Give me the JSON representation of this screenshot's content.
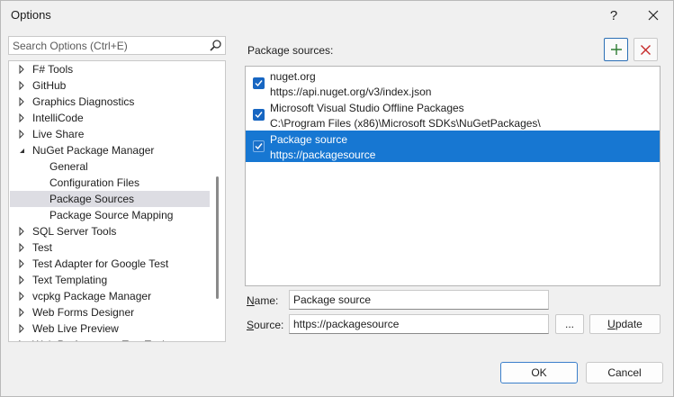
{
  "window": {
    "title": "Options",
    "help_label": "?"
  },
  "search": {
    "placeholder": "Search Options (Ctrl+E)"
  },
  "tree": {
    "items": [
      {
        "label": "F# Tools",
        "level": 0,
        "expandable": true,
        "expanded": false
      },
      {
        "label": "GitHub",
        "level": 0,
        "expandable": true,
        "expanded": false
      },
      {
        "label": "Graphics Diagnostics",
        "level": 0,
        "expandable": true,
        "expanded": false
      },
      {
        "label": "IntelliCode",
        "level": 0,
        "expandable": true,
        "expanded": false
      },
      {
        "label": "Live Share",
        "level": 0,
        "expandable": true,
        "expanded": false
      },
      {
        "label": "NuGet Package Manager",
        "level": 0,
        "expandable": true,
        "expanded": true
      },
      {
        "label": "General",
        "level": 1,
        "expandable": false
      },
      {
        "label": "Configuration Files",
        "level": 1,
        "expandable": false
      },
      {
        "label": "Package Sources",
        "level": 1,
        "expandable": false,
        "selected": true
      },
      {
        "label": "Package Source Mapping",
        "level": 1,
        "expandable": false
      },
      {
        "label": "SQL Server Tools",
        "level": 0,
        "expandable": true,
        "expanded": false
      },
      {
        "label": "Test",
        "level": 0,
        "expandable": true,
        "expanded": false
      },
      {
        "label": "Test Adapter for Google Test",
        "level": 0,
        "expandable": true,
        "expanded": false
      },
      {
        "label": "Text Templating",
        "level": 0,
        "expandable": true,
        "expanded": false
      },
      {
        "label": "vcpkg Package Manager",
        "level": 0,
        "expandable": true,
        "expanded": false
      },
      {
        "label": "Web Forms Designer",
        "level": 0,
        "expandable": true,
        "expanded": false
      },
      {
        "label": "Web Live Preview",
        "level": 0,
        "expandable": true,
        "expanded": false
      },
      {
        "label": "Web Performance Test Tools",
        "level": 0,
        "expandable": true,
        "expanded": false
      }
    ]
  },
  "sources_panel": {
    "label": "Package sources:",
    "add_icon": "plus-icon",
    "remove_icon": "x-icon",
    "sources": [
      {
        "name": "nuget.org",
        "url": "https://api.nuget.org/v3/index.json",
        "checked": true,
        "selected": false
      },
      {
        "name": "Microsoft Visual Studio Offline Packages",
        "url": "C:\\Program Files (x86)\\Microsoft SDKs\\NuGetPackages\\",
        "checked": true,
        "selected": false
      },
      {
        "name": "Package source",
        "url": "https://packagesource",
        "checked": true,
        "selected": true
      }
    ]
  },
  "form": {
    "name_label_mnemonic": "N",
    "name_label_rest": "ame:",
    "name_value": "Package source",
    "source_label_mnemonic": "S",
    "source_label_rest": "ource:",
    "source_value": "https://packagesource",
    "browse_label": "...",
    "update_label_mnemonic": "U",
    "update_label_rest": "pdate"
  },
  "footer": {
    "ok_label": "OK",
    "cancel_label": "Cancel"
  },
  "colors": {
    "accent": "#1777d2",
    "checkbox": "#1766c2",
    "add_green": "#2e7d32",
    "remove_red": "#c62828"
  }
}
